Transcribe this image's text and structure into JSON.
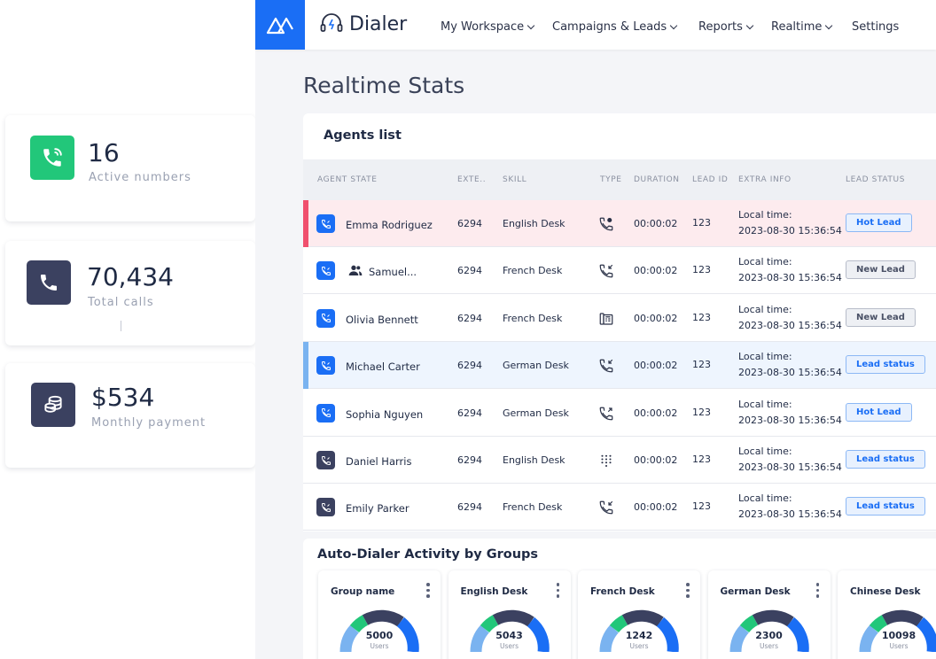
{
  "stats": [
    {
      "value": "16",
      "label": "Active numbers",
      "icon": "phone-ringing-icon",
      "color": "#22c77a"
    },
    {
      "value": "70,434",
      "label": "Total calls",
      "icon": "phone-icon",
      "color": "#3b4160"
    },
    {
      "value": "$534",
      "label": "Monthly payment",
      "icon": "coins-icon",
      "color": "#3b4160"
    }
  ],
  "nav": {
    "brand": "Dialer",
    "items": [
      "My Workspace",
      "Campaigns & Leads",
      "Reports",
      "Realtime",
      "Settings"
    ]
  },
  "page_title": "Realtime Stats",
  "agents": {
    "title": "Agents list",
    "columns": [
      "AGENT STATE",
      "EXTE..",
      "SKILL",
      "TYPE",
      "DURATION",
      "LEAD ID",
      "EXTRA INFO",
      "LEAD STATUS"
    ],
    "rows": [
      {
        "name": "Emma Rodriguez",
        "ext": "6294",
        "skill": "English Desk",
        "type": "phone-settings-icon",
        "duration": "00:00:02",
        "lead_id": "123",
        "info_label": "Local time:",
        "info_time": "2023-08-30 15:36:54",
        "status": "Hot Lead",
        "status_style": "blue",
        "highlight": "red",
        "agent_icon_color": "#1a6ef5"
      },
      {
        "name": "Samuel...",
        "ext": "6294",
        "skill": "French Desk",
        "type": "phone-incoming-icon",
        "duration": "00:00:02",
        "lead_id": "123",
        "info_label": "Local time:",
        "info_time": "2023-08-30 15:36:54",
        "status": "New Lead",
        "status_style": "gray",
        "highlight": "none",
        "agent_icon_color": "#1a6ef5",
        "group": true
      },
      {
        "name": "Olivia Bennett",
        "ext": "6294",
        "skill": "French Desk",
        "type": "fax-icon",
        "duration": "00:00:02",
        "lead_id": "123",
        "info_label": "Local time:",
        "info_time": "2023-08-30 15:36:54",
        "status": "New Lead",
        "status_style": "gray",
        "highlight": "none",
        "agent_icon_color": "#1a6ef5"
      },
      {
        "name": "Michael Carter",
        "ext": "6294",
        "skill": "German Desk",
        "type": "phone-incoming-icon",
        "duration": "00:00:02",
        "lead_id": "123",
        "info_label": "Local time:",
        "info_time": "2023-08-30 15:36:54",
        "status": "Lead status",
        "status_style": "blue",
        "highlight": "blue",
        "agent_icon_color": "#1a6ef5"
      },
      {
        "name": "Sophia Nguyen",
        "ext": "6294",
        "skill": "German Desk",
        "type": "phone-outgoing-icon",
        "duration": "00:00:02",
        "lead_id": "123",
        "info_label": "Local time:",
        "info_time": "2023-08-30 15:36:54",
        "status": "Hot Lead",
        "status_style": "blue",
        "highlight": "none",
        "agent_icon_color": "#1a6ef5"
      },
      {
        "name": "Daniel Harris",
        "ext": "6294",
        "skill": "English Desk",
        "type": "dialpad-icon",
        "duration": "00:00:02",
        "lead_id": "123",
        "info_label": "Local time:",
        "info_time": "2023-08-30 15:36:54",
        "status": "Lead status",
        "status_style": "blue",
        "highlight": "none",
        "agent_icon_color": "#3b4160"
      },
      {
        "name": "Emily Parker",
        "ext": "6294",
        "skill": "French Desk",
        "type": "phone-incoming-icon",
        "duration": "00:00:02",
        "lead_id": "123",
        "info_label": "Local time:",
        "info_time": "2023-08-30 15:36:54",
        "status": "Lead status",
        "status_style": "blue",
        "highlight": "none",
        "agent_icon_color": "#3b4160"
      }
    ]
  },
  "groups": {
    "title": "Auto-Dialer Activity by Groups",
    "cards": [
      {
        "name": "Group name",
        "value": "5000",
        "unit": "Users"
      },
      {
        "name": "English Desk",
        "value": "5043",
        "unit": "Users"
      },
      {
        "name": "French Desk",
        "value": "1242",
        "unit": "Users"
      },
      {
        "name": "German Desk",
        "value": "2300",
        "unit": "Users"
      },
      {
        "name": "Chinese Desk",
        "value": "10098",
        "unit": "Users"
      }
    ]
  },
  "colors": {
    "accent": "#1a6ef5",
    "success": "#22c77a",
    "dark": "#3b4160",
    "alert": "#f0506e",
    "highlight": "#7ab3f0"
  }
}
